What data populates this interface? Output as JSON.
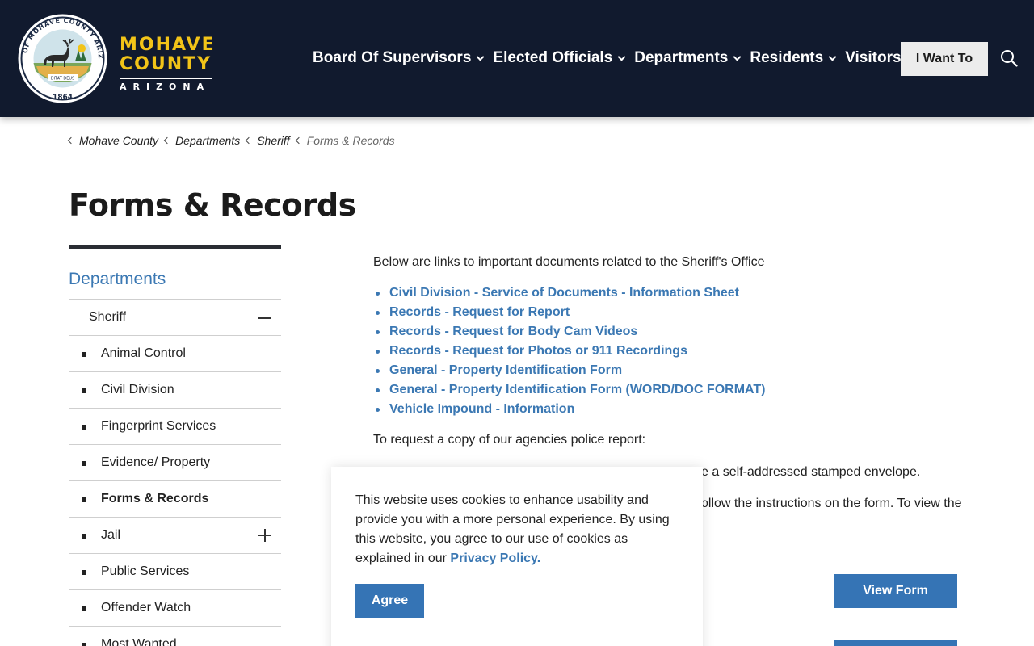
{
  "brand": {
    "line1": "MOHAVE",
    "line2": "COUNTY",
    "line3": "ARIZONA",
    "seal_top_text": "SEAL OF MOHAVE COUNTY ARIZONA",
    "seal_motto": "DITAT DEUS",
    "seal_year": "1864",
    "colors": {
      "header_bg": "#111a2e",
      "gold": "#f2c418",
      "link_blue": "#3b78b3",
      "button_blue": "#3574b5"
    }
  },
  "nav": {
    "items": [
      {
        "label": "Board Of Supervisors"
      },
      {
        "label": "Elected Officials"
      },
      {
        "label": "Departments"
      },
      {
        "label": "Residents"
      },
      {
        "label": "Visitors"
      }
    ],
    "cta_label": "I Want To",
    "search_icon": "search-icon"
  },
  "breadcrumb": [
    {
      "label": "Mohave County"
    },
    {
      "label": "Departments"
    },
    {
      "label": "Sheriff"
    },
    {
      "label": "Forms & Records"
    }
  ],
  "page": {
    "title": "Forms & Records"
  },
  "sidebar": {
    "heading": "Departments",
    "parent": "Sheriff",
    "items": [
      {
        "label": "Animal Control"
      },
      {
        "label": "Civil Division"
      },
      {
        "label": "Fingerprint Services"
      },
      {
        "label": "Evidence/ Property"
      },
      {
        "label": "Forms & Records"
      },
      {
        "label": "Jail"
      },
      {
        "label": "Public Services"
      },
      {
        "label": "Offender Watch"
      },
      {
        "label": "Most Wanted"
      }
    ]
  },
  "main": {
    "intro": "Below are links to important documents related to the Sheriff's Office",
    "documents": [
      "Civil Division - Service of Documents - Information Sheet",
      "Records - Request for Report",
      "Records - Request for Body Cam Videos",
      "Records - Request for Photos or 911 Recordings",
      "General - Property Identification Form",
      "General - Property Identification Form (WORD/DOC FORMAT)",
      "Vehicle Impound - Information"
    ],
    "request_heading": "To request a copy of our agencies police report:",
    "partial_line_a": "e a self-addressed stamped envelope.",
    "partial_line_b": "ollow the instructions on the form. To view the",
    "view_form_label": "View Form"
  },
  "cookie": {
    "text": "This website uses cookies to enhance usability and provide you with a more personal experience. By using this website, you agree to our use of cookies as explained in our ",
    "link": "Privacy Policy.",
    "agree_label": "Agree"
  }
}
